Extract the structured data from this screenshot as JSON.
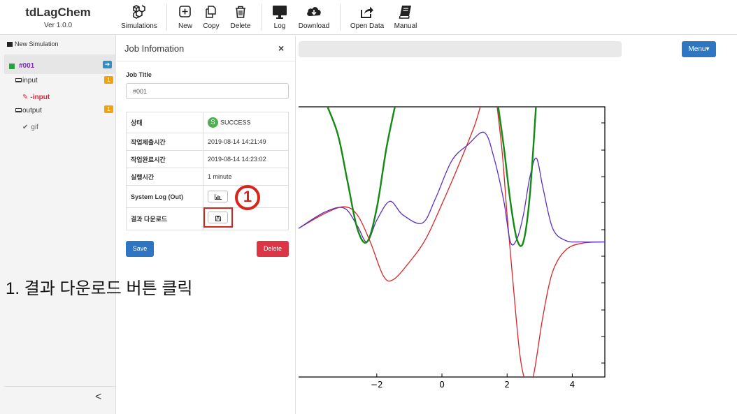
{
  "app": {
    "title": "tdLagChem",
    "version": "Ver 1.0.0"
  },
  "toolbar": {
    "simulations": "Simulations",
    "new": "New",
    "copy": "Copy",
    "delete": "Delete",
    "log": "Log",
    "download": "Download",
    "open_data": "Open Data",
    "manual": "Manual"
  },
  "sidebar": {
    "new_simulation": "New Simulation",
    "job_id": "#001",
    "input_label": "input",
    "input_badge": "1",
    "input_child": "-input",
    "output_label": "output",
    "output_badge": "1",
    "output_child": "gif",
    "collapse_icon": "<"
  },
  "panel": {
    "title": "Job Infomation",
    "close": "×",
    "job_title_label": "Job Title",
    "job_title_value": "#001",
    "rows": {
      "status_key": "상태",
      "status_value": "SUCCESS",
      "status_icon_letter": "S",
      "submit_key": "작업제출시간",
      "submit_value": "2019-08-14 14:21:49",
      "done_key": "작업완료시간",
      "done_value": "2019-08-14 14:23:02",
      "runtime_key": "실행시간",
      "runtime_value": "1 minute",
      "syslog_key": "System Log (Out)",
      "download_key": "결과 다운로드"
    },
    "save": "Save",
    "delete": "Delete"
  },
  "main": {
    "menu": "Menu▾"
  },
  "annotation": {
    "marker": "1",
    "caption": "1. 결과 다운로드 버튼 클릭"
  },
  "colors": {
    "accent_blue": "#2e76c2",
    "danger_red": "#dc3545",
    "warning_orange": "#f0a30a",
    "success_green": "#4caf50",
    "job_purple": "#7b2fa8",
    "input_red": "#e0263e",
    "highlight_red": "#d9241c"
  },
  "chart_data": {
    "type": "line",
    "x_ticks": [
      "−2",
      "0",
      "2",
      "4"
    ],
    "x_tick_values": [
      -2,
      0,
      2,
      4
    ],
    "xlim": [
      -4.4,
      5.0
    ],
    "ylim": [
      -1.0,
      1.0
    ],
    "series": [
      {
        "color": "#d62728",
        "x": [
          -4.4,
          -3.6,
          -3.0,
          -2.6,
          -2.2,
          -1.8,
          -1.5,
          -1.0,
          -0.5,
          0.0,
          0.5,
          1.0,
          1.5,
          1.8,
          2.0,
          2.2,
          2.4,
          2.6,
          2.8,
          3.1,
          3.4,
          3.8,
          4.3,
          5.0
        ],
        "y": [
          0.1,
          0.21,
          0.26,
          0.2,
          0.0,
          -0.25,
          -0.28,
          -0.15,
          0.02,
          0.28,
          0.56,
          0.86,
          1.2,
          0.78,
          0.2,
          -0.35,
          -0.85,
          -1.05,
          -1.0,
          -0.55,
          -0.22,
          -0.06,
          -0.01,
          0.0
        ]
      },
      {
        "color": "#5b2fc4",
        "x": [
          -4.4,
          -3.6,
          -3.0,
          -2.6,
          -2.3,
          -2.0,
          -1.6,
          -1.2,
          -0.6,
          -0.2,
          0.3,
          0.8,
          1.3,
          1.6,
          1.9,
          2.1,
          2.3,
          2.5,
          2.7,
          2.9,
          3.1,
          3.4,
          3.8,
          4.3,
          5.0
        ],
        "y": [
          0.1,
          0.22,
          0.25,
          0.12,
          0.0,
          0.16,
          0.3,
          0.2,
          0.14,
          0.32,
          0.6,
          0.72,
          0.81,
          0.62,
          0.3,
          0.0,
          0.02,
          0.2,
          0.48,
          0.62,
          0.4,
          0.1,
          0.01,
          0.0,
          0.0
        ]
      },
      {
        "color": "#138a13",
        "x": [
          -3.6,
          -3.2,
          -2.9,
          -2.6,
          -2.3,
          -2.0,
          -1.7,
          -1.4,
          1.7,
          1.9,
          2.1,
          2.3,
          2.5,
          2.7,
          2.9
        ],
        "y": [
          1.05,
          0.8,
          0.45,
          0.1,
          0.0,
          0.25,
          0.7,
          1.05,
          1.05,
          0.7,
          0.3,
          0.02,
          0.0,
          0.35,
          1.05
        ]
      }
    ]
  }
}
